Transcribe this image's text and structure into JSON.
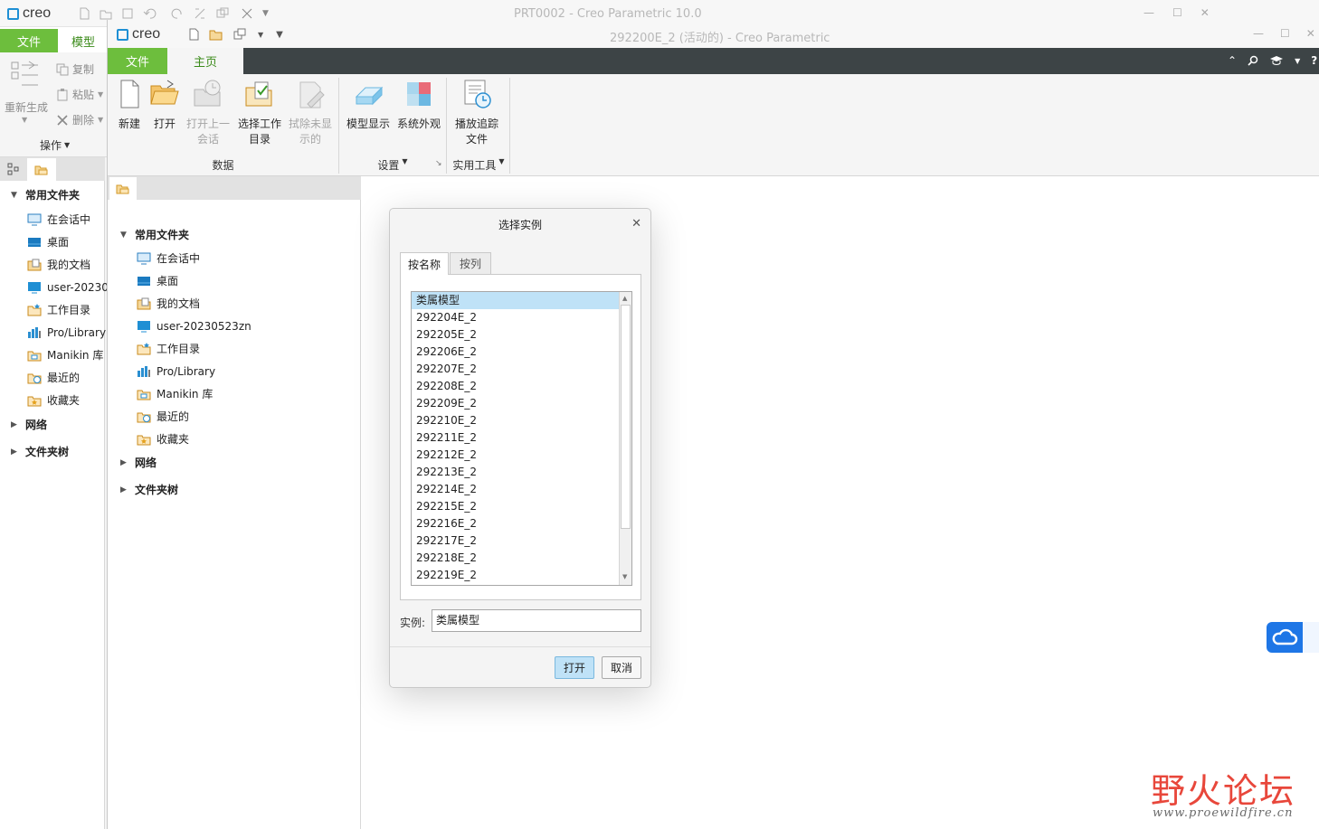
{
  "back_window": {
    "app_brand": "creo",
    "title": "PRT0002 - Creo Parametric 10.0",
    "tabs": {
      "file": "文件",
      "model": "模型"
    },
    "ribbon": {
      "regenerate": "重新生成",
      "copy": "复制",
      "paste": "粘贴",
      "delete": "删除",
      "group_operations": "操作"
    },
    "nav": {
      "favorites_header": "常用文件夹",
      "items": [
        "在会话中",
        "桌面",
        "我的文档",
        "user-20230",
        "工作目录",
        "Pro/Library",
        "Manikin 库",
        "最近的",
        "收藏夹"
      ],
      "network": "网络",
      "folder_tree": "文件夹树"
    }
  },
  "front_window": {
    "app_brand": "creo",
    "title": "292200E_2 (活动的) - Creo Parametric",
    "tabs": {
      "file": "文件",
      "home": "主页"
    },
    "ribbon": {
      "new": "新建",
      "open": "打开",
      "open_last_1": "打开上一",
      "open_last_2": "会话",
      "select_dir_1": "选择工作",
      "select_dir_2": "目录",
      "erase_1": "拭除未显",
      "erase_2": "示的",
      "group_data": "数据",
      "model_display": "模型显示",
      "system_appearance": "系统外观",
      "group_settings": "设置",
      "play_trail_1": "播放追踪",
      "play_trail_2": "文件",
      "group_utilities": "实用工具"
    },
    "nav": {
      "favorites_header": "常用文件夹",
      "items": [
        "在会话中",
        "桌面",
        "我的文档",
        "user-20230523zn",
        "工作目录",
        "Pro/Library",
        "Manikin 库",
        "最近的",
        "收藏夹"
      ],
      "network": "网络",
      "folder_tree": "文件夹树"
    }
  },
  "dialog": {
    "title": "选择实例",
    "tabs": [
      "按名称",
      "按列"
    ],
    "list": [
      "类属模型",
      "292204E_2",
      "292205E_2",
      "292206E_2",
      "292207E_2",
      "292208E_2",
      "292209E_2",
      "292210E_2",
      "292211E_2",
      "292212E_2",
      "292213E_2",
      "292214E_2",
      "292215E_2",
      "292216E_2",
      "292217E_2",
      "292218E_2",
      "292219E_2"
    ],
    "instance_label": "实例:",
    "instance_value": "类属模型",
    "open_button": "打开",
    "cancel_button": "取消"
  },
  "watermark": {
    "brand": "野火论坛",
    "url": "www.proewildfire.cn"
  },
  "colors": {
    "accent_green": "#6dbe3d",
    "dark_tabbar": "#3d4446",
    "selection_blue": "#bfe2f7",
    "primary_button": "#bfe2f7",
    "cloud_blue": "#1e76e6",
    "watermark_red": "#e8473b"
  }
}
